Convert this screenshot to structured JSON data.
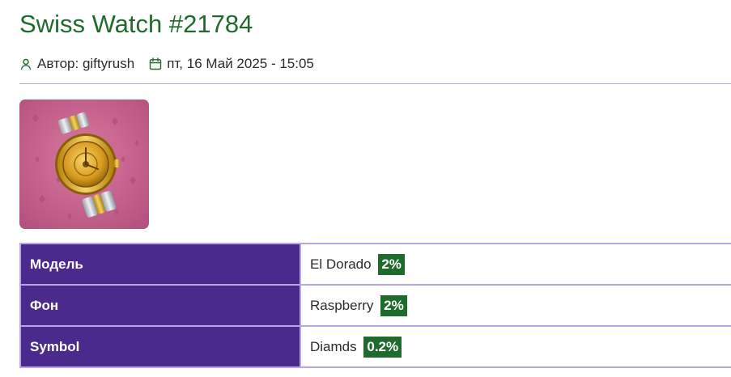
{
  "page": {
    "title": "Swiss Watch #21784"
  },
  "meta": {
    "author_label": "Автор: giftyrush",
    "date": "пт, 16 Май 2025 - 15:05",
    "author_icon": "user-icon",
    "date_icon": "calendar-icon"
  },
  "image": {
    "description_icon": "gold-watch",
    "background_color": "#c05f8c"
  },
  "attributes": [
    {
      "label": "Модель",
      "value": "El Dorado",
      "rarity": "2%"
    },
    {
      "label": "Фон",
      "value": "Raspberry",
      "rarity": "2%"
    },
    {
      "label": "Symbol",
      "value": "Diamds",
      "rarity": "0.2%"
    }
  ],
  "colors": {
    "title": "#1f6b2e",
    "label_bg": "#4a2a8c",
    "badge_bg": "#1e6b2d",
    "border": "#b9a6e4"
  }
}
